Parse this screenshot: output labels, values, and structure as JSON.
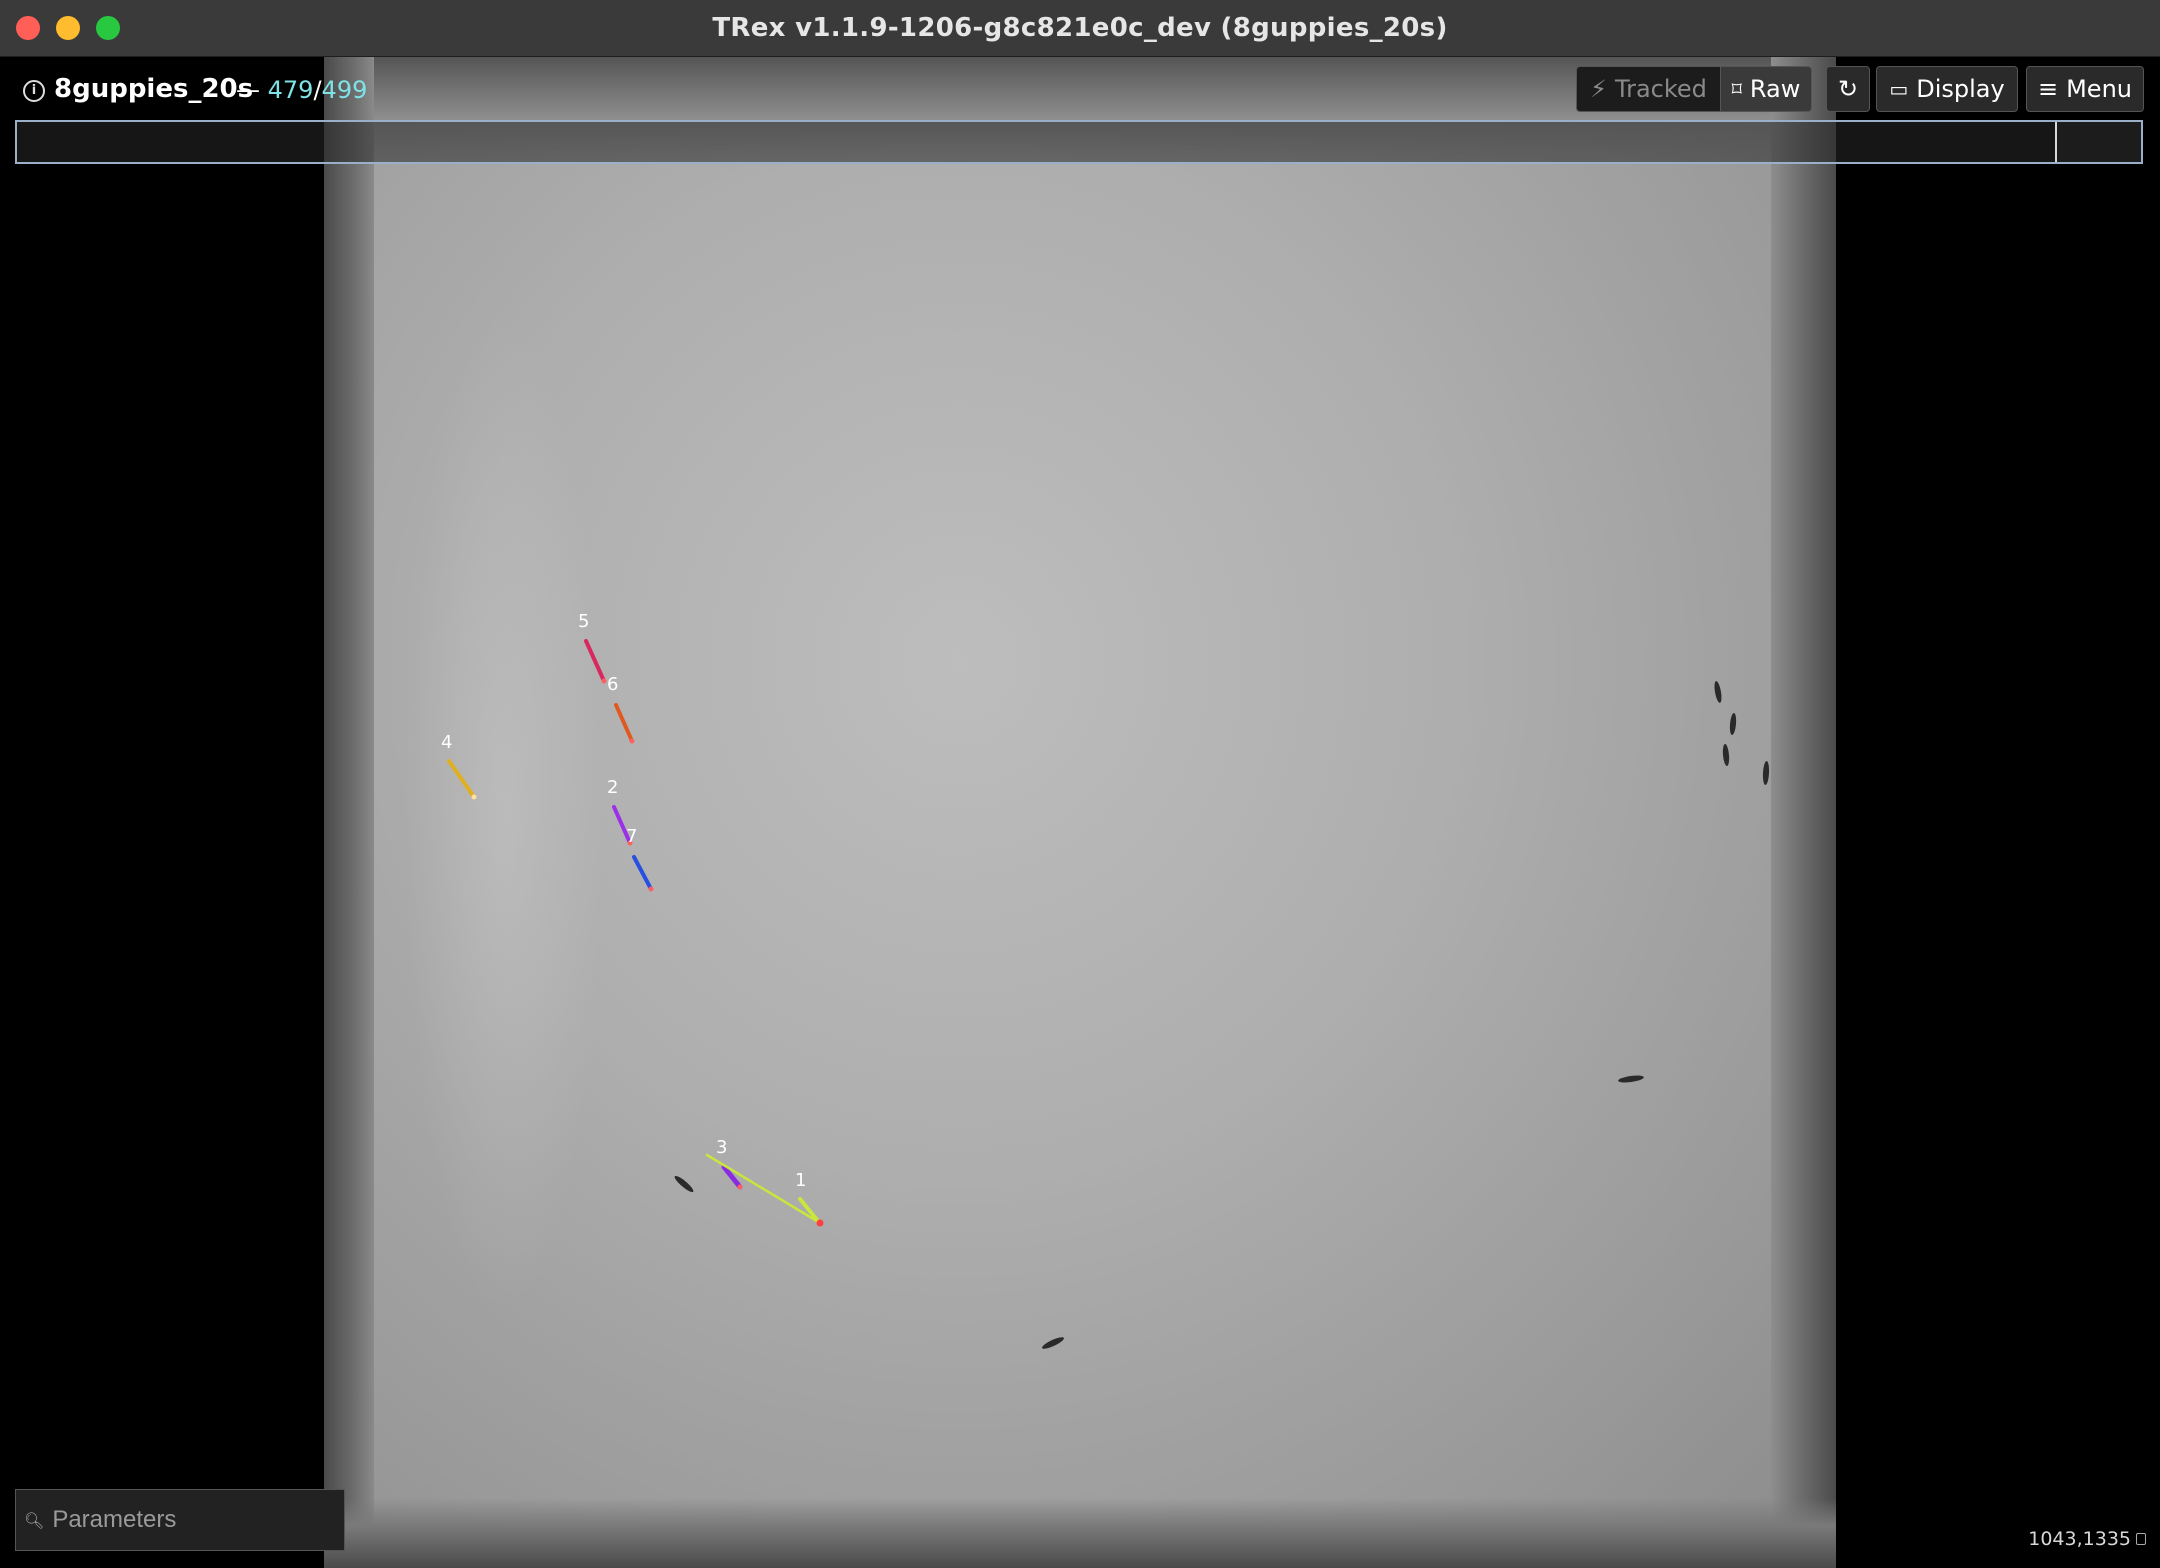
{
  "window": {
    "title": "TRex v1.1.9-1206-g8c821e0c_dev (8guppies_20s)"
  },
  "header": {
    "info_icon": "info-icon",
    "video_name": "8guppies_20s",
    "separator": "—",
    "frame_current": "479",
    "frame_slash": "/",
    "frame_total": "499"
  },
  "toolbar": {
    "tracked_label": "Tracked",
    "tracked_icon": "bolt-icon",
    "raw_label": "Raw",
    "raw_icon": "raw-icon",
    "reload_icon": "reload-icon",
    "display_label": "Display",
    "display_icon": "monitor-icon",
    "menu_label": "Menu",
    "menu_icon": "hamburger-icon"
  },
  "command_bar": {
    "value": ""
  },
  "parameters": {
    "placeholder": "Parameters",
    "icon": "search-icon"
  },
  "status": {
    "coordinates": "1043,1335"
  },
  "tracked_fish": [
    {
      "id": "1",
      "color": "#c8e63c"
    },
    {
      "id": "2",
      "color": "#9b30e8"
    },
    {
      "id": "3",
      "color": "#8a2be2"
    },
    {
      "id": "4",
      "color": "#e0b020"
    },
    {
      "id": "5",
      "color": "#d82860"
    },
    {
      "id": "6",
      "color": "#e05a20"
    },
    {
      "id": "7",
      "color": "#2850e0"
    }
  ],
  "colors": {
    "accent_frame": "#7fe3e6",
    "command_border": "#9ab0c8"
  }
}
